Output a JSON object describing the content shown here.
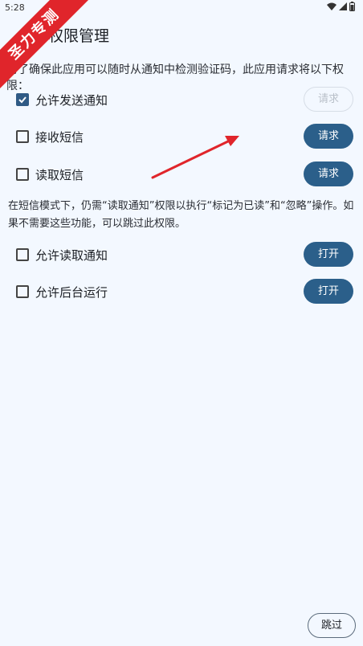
{
  "status_bar": {
    "time": "5:28"
  },
  "watermark": {
    "text": "圣力专测"
  },
  "header": {
    "title": "权限管理"
  },
  "intro_text": "为了确保此应用可以随时从通知中检测验证码，此应用请求将以下权限：",
  "permissions": [
    {
      "label": "允许发送通知",
      "checked": true,
      "action": "请求",
      "enabled": false
    },
    {
      "label": "接收短信",
      "checked": false,
      "action": "请求",
      "enabled": true
    },
    {
      "label": "读取短信",
      "checked": false,
      "action": "请求",
      "enabled": true
    }
  ],
  "note_text": "在短信模式下，仍需“读取通知”权限以执行“标记为已读”和“忽略”操作。如果不需要这些功能，可以跳过此权限。",
  "extra_permissions": [
    {
      "label": "允许读取通知",
      "checked": false,
      "action": "打开",
      "enabled": true
    },
    {
      "label": "允许后台运行",
      "checked": false,
      "action": "打开",
      "enabled": true
    }
  ],
  "footer": {
    "skip_label": "跳过"
  },
  "colors": {
    "accent": "#2b5f8a",
    "background": "#f3f8ff",
    "annotation": "#e0252b"
  }
}
